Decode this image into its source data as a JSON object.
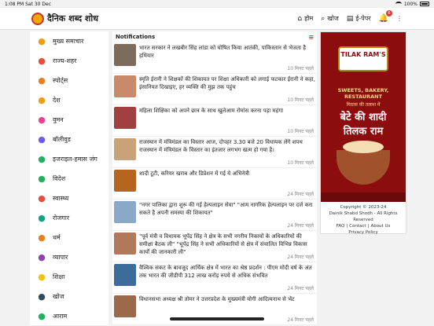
{
  "statusbar": {
    "time": "1:08 PM",
    "date": "Sat 30 Dec",
    "battery": "100%"
  },
  "header": {
    "brand": "दैनिक शब्द शोध",
    "nav": [
      {
        "label": "होम",
        "icon": "home-icon"
      },
      {
        "label": "खोज",
        "icon": "search-icon"
      },
      {
        "label": "ई-पेपर",
        "icon": "epaper-icon"
      }
    ],
    "notification_count": "6"
  },
  "sidebar": {
    "items": [
      {
        "label": "मुख्य समाचार",
        "icon": "flame-icon",
        "color": "#f39c12"
      },
      {
        "label": "राज्य-शहर",
        "icon": "location-icon",
        "color": "#e74c3c"
      },
      {
        "label": "स्पोर्ट्स",
        "icon": "sports-icon",
        "color": "#e67e22"
      },
      {
        "label": "देश",
        "icon": "building-icon",
        "color": "#f39c12"
      },
      {
        "label": "वुमन",
        "icon": "heart-icon",
        "color": "#e84393"
      },
      {
        "label": "बॉलीवुड",
        "icon": "film-icon",
        "color": "#6c5ce7"
      },
      {
        "label": "इजराइल-हमास जंग",
        "icon": "war-icon",
        "color": "#27ae60"
      },
      {
        "label": "विदेश",
        "icon": "globe-icon",
        "color": "#27ae60"
      },
      {
        "label": "स्वास्थ्य",
        "icon": "health-icon",
        "color": "#e74c3c"
      },
      {
        "label": "रोजगार",
        "icon": "job-icon",
        "color": "#16a085"
      },
      {
        "label": "धर्म",
        "icon": "religion-icon",
        "color": "#e67e22"
      },
      {
        "label": "व्यापार",
        "icon": "business-icon",
        "color": "#8e44ad"
      },
      {
        "label": "शिक्षा",
        "icon": "education-icon",
        "color": "#f1c40f"
      },
      {
        "label": "खोज",
        "icon": "search-icon",
        "color": "#34495e"
      },
      {
        "label": "आराम",
        "icon": "rest-icon",
        "color": "#27ae60"
      }
    ]
  },
  "feed": {
    "title": "Notifications",
    "items": [
      {
        "text": "भारत सरकार ने लखबीर सिंह लांडा को घोषित किया आतंकी, पाकिस्तान से भेजता है हथियार",
        "time": "10 मिनट पहले",
        "thumb": "#7d6b5b"
      },
      {
        "text": "स्मृति ईरानी ने शिक्षकों की शिकायत पर शिक्षा अधिकारी को लगाई फटकार ईरानी ने कहा, इंसानियत दिखाइए, हर व्यक्ति की मुझ तक पहुंच",
        "time": "10 मिनट पहले",
        "thumb": "#c98a6b"
      },
      {
        "text": "महिला शिक्षिका को अपने छात्र के साथ खुलेआम रोमांस करना पड़ा महंगा",
        "time": "10 मिनट पहले",
        "thumb": "#a04040"
      },
      {
        "text": "राजस्थान में मंत्रिमंडल का विस्तार आज, दोपहर 3.30 बजे 20 विधायक लेंगे शपथ राजस्थान में मंत्रिमंडल के विस्तार का इंतजार लगभग खत्म हो गया है।",
        "time": "10 मिनट पहले",
        "thumb": "#c9a27a"
      },
      {
        "text": "शादी टूटी, करियर खराब और डिप्रेशन में गई ये अभिनेत्री",
        "time": "24 मिनट पहले",
        "thumb": "#b5651d"
      },
      {
        "text": "\"नगर पालिका द्वारा शुरू की गई हेल्पलाइन सेवा\" \"आम नागरिक हेल्पलाइन पर दर्ज करा सकते है अपनी समस्या की शिकायत\"",
        "time": "24 मिनट पहले",
        "thumb": "#8aa8c8"
      },
      {
        "text": "\"पूर्व मंत्री व विधायक भूपेंद्र सिंह ने क्षेत्र के सभी नगरीय निकायों के अधिकारियों की समीक्षा बैठक ली\" \"भूपेंद्र सिंह ने सभी अधिकारियों से क्षेत्र में संचालित विभिन्न विकास कार्यों की जानकारी ली\"",
        "time": "24 मिनट पहले",
        "thumb": "#b07a5a"
      },
      {
        "text": "वैश्विक संकट के बावजूद आर्थिक क्षेत्र में भारत का श्रेष्ठ प्रदर्शन : पीएम मोदी वर्ष के अंत तक भारत की जीडीपी 312 लाख करोड़ रुपये से अधिक संभवित",
        "time": "24 मिनट पहले",
        "thumb": "#3d6b9a"
      },
      {
        "text": "विधानसभा अध्यक्ष श्री तोमर ने उत्तरप्रदेश के मुख्यमंत्री योगी आदित्यनाथ से भेंट",
        "time": "24 मिनट पहले",
        "thumb": "#9a6a4a"
      }
    ]
  },
  "ad": {
    "brand": "TILAK RAM'S",
    "tagline": "SWEETS, BAKERY, RESTAURANT",
    "line1": "मिठास की तलाश में",
    "line2": "बेटे की शादी",
    "line3": "तिलक राम"
  },
  "footer": {
    "copyright": "Copyright © 2023-24",
    "rights": "Dainik Shabd Shodh - All Rights Reserved",
    "links": [
      "FAQ",
      "Contact",
      "About Us"
    ],
    "privacy": "Privacy Policy"
  }
}
